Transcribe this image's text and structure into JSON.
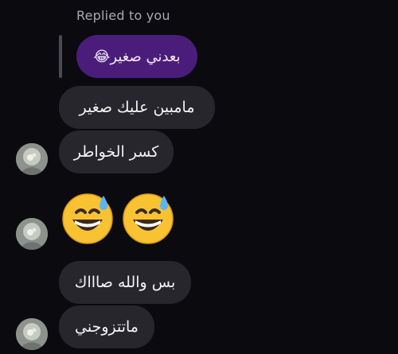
{
  "reply": {
    "label": "Replied to you",
    "quoted_text": "بعدني صغير😂"
  },
  "messages": [
    {
      "text": "مامبين عليك صغير"
    },
    {
      "text": "كسر الخواطر"
    },
    {
      "emoji": [
        "grinning-face-with-sweat",
        "grinning-face-with-sweat"
      ]
    },
    {
      "text": "بس والله صاااك"
    },
    {
      "text": "ماتتزوجني"
    }
  ],
  "colors": {
    "background": "#0b0b0f",
    "incoming_bubble": "#26262c",
    "reply_bubble": "#4a1d7a",
    "reply_label": "#a8a8b3"
  }
}
